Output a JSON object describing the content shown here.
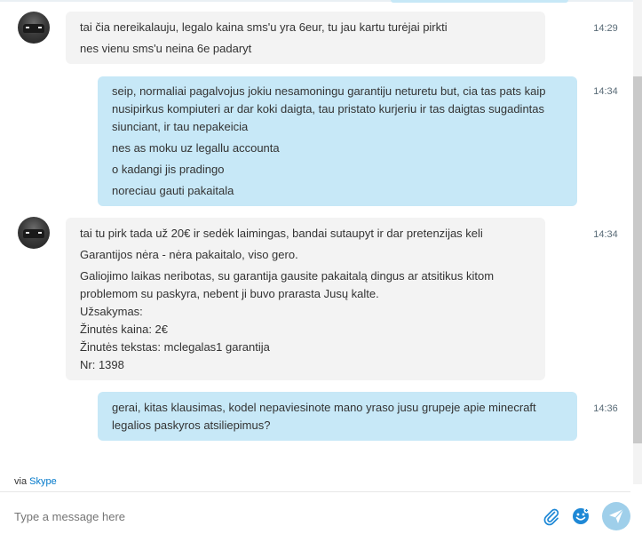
{
  "messages": [
    {
      "direction": "in",
      "time": "14:29",
      "lines": [
        "tai čia nereikalauju, legalo kaina sms'u yra 6eur, tu jau kartu turėjai pirkti",
        "nes vienu sms'u neina 6e padaryt"
      ]
    },
    {
      "direction": "out",
      "time": "14:34",
      "lines": [
        "seip, normaliai pagalvojus jokiu nesamoningu garantiju neturetu but, cia tas pats kaip nusipirkus kompiuteri ar dar koki daigta, tau pristato kurjeriu ir tas daigtas sugadintas siunciant, ir tau nepakeicia",
        "nes as moku uz legallu accounta",
        "o kadangi jis pradingo",
        "noreciau gauti pakaitala"
      ]
    },
    {
      "direction": "in",
      "time": "14:34",
      "lines": [
        "tai tu pirk tada už 20€ ir sedėk laimingas, bandai sutaupyt ir dar pretenzijas keli",
        "Garantijos nėra - nėra pakaitalo, viso gero.",
        "Galiojimo laikas neribotas, su garantija gausite pakaitalą dingus ar atsitikus kitom problemom su paskyra, nebent ji buvo prarasta Jusų kalte.\nUžsakymas:\nŽinutės kaina: 2€\nŽinutės tekstas: mclegalas1 garantija\nNr: 1398"
      ]
    },
    {
      "direction": "out",
      "time": "14:36",
      "lines": [
        "gerai, kitas klausimas, kodel nepaviesinote mano yraso jusu grupeje apie minecraft legalios paskyros atsiliepimus?"
      ]
    }
  ],
  "footer": {
    "via_prefix": "via",
    "via_link": "Skype"
  },
  "composer": {
    "placeholder": "Type a message here"
  },
  "icons": {
    "attach": "paperclip-icon",
    "emoticon": "smiley-icon",
    "send": "send-icon"
  },
  "colors": {
    "incoming_bubble": "#f3f3f3",
    "outgoing_bubble": "#c7e8f7",
    "skype_blue": "#0078ca",
    "send_button": "#9fcfea"
  }
}
